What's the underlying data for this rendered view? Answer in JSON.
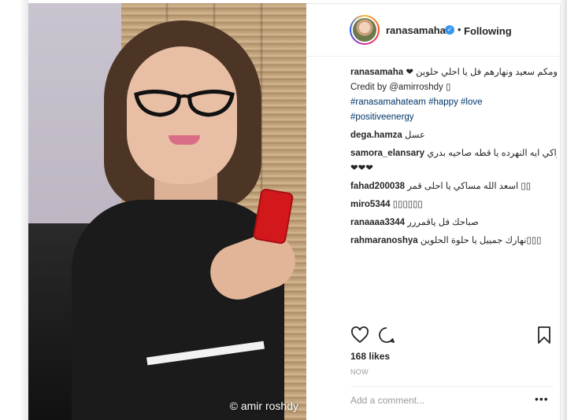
{
  "post": {
    "username": "ranasamaha",
    "following_label": "Following",
    "dot": "•",
    "verified_glyph": "✓",
    "watermark": "© amir roshdy",
    "likes": "168 likes",
    "time": "NOW",
    "add_comment_placeholder": "Add a comment...",
    "more_glyph": "•••"
  },
  "comments": [
    {
      "user": "ranasamaha",
      "text": " ❤ يومكم سعيد ونهارهم فل يا احلي حلوين"
    },
    {
      "user": "",
      "text": "Credit by @amirroshdy ▯"
    },
    {
      "user": "",
      "text": "#ranasamahateam #happy #love"
    },
    {
      "user": "",
      "text": "#positiveenergy"
    },
    {
      "user": "dega.hamza",
      "text": " عسل"
    },
    {
      "user": "samora_elansary",
      "text": " وراكي ايه النهرده يا قطه صاحيه بدري"
    },
    {
      "user": "",
      "text": "❤❤❤"
    },
    {
      "user": "fahad200038",
      "text": " اسعد الله مساكي يا احلى قمر ▯▯"
    },
    {
      "user": "miro5344",
      "text": " ▯▯▯▯▯▯"
    },
    {
      "user": "ranaaaa3344",
      "text": " صباحك فل ياقمررر"
    },
    {
      "user": "rahmaranoshya",
      "text": " نهارك جمييل يا حلوة الحلوين▯▯▯"
    }
  ],
  "icons": [
    "heart-icon",
    "comment-icon",
    "bookmark-icon",
    "verified-icon"
  ],
  "colors": {
    "link": "#003569",
    "verified": "#3897f0",
    "muted": "#999999"
  }
}
